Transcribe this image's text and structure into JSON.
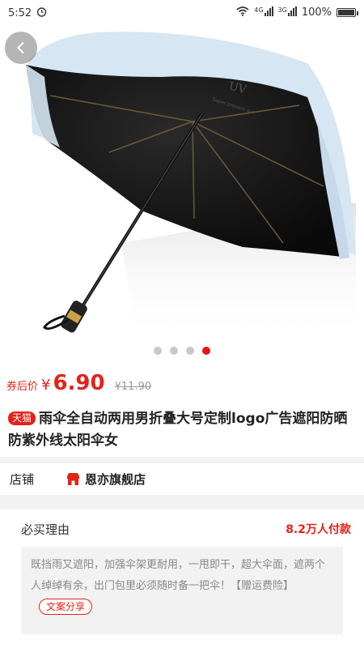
{
  "status": {
    "time": "5:52",
    "signal_a": "4G",
    "signal_b": "3G",
    "battery": "100%"
  },
  "gallery": {
    "image_text": "UV",
    "image_subtext": "Super prevent sun",
    "dot_count": 4,
    "active_index": 3
  },
  "price": {
    "coupon_label": "券后价",
    "currency": "¥",
    "value": "6.90",
    "original": "¥11.90"
  },
  "product": {
    "badge": "天猫",
    "title": "雨伞全自动两用男折叠大号定制logo广告遮阳防晒防紫外线太阳伞女"
  },
  "shop": {
    "label": "店铺",
    "name": "恩亦旗舰店"
  },
  "reason": {
    "title": "必买理由",
    "paid": "8.2万人付款",
    "text": "既挡雨又遮阳，加强伞架更耐用，一甩即干，超大伞面，遮两个人绰绰有余，出门包里必须随时备一把伞！【赠运费险】",
    "share_label": "文案分享"
  },
  "colors": {
    "accent": "#e2231a",
    "canopy": "#d6e6f3"
  }
}
